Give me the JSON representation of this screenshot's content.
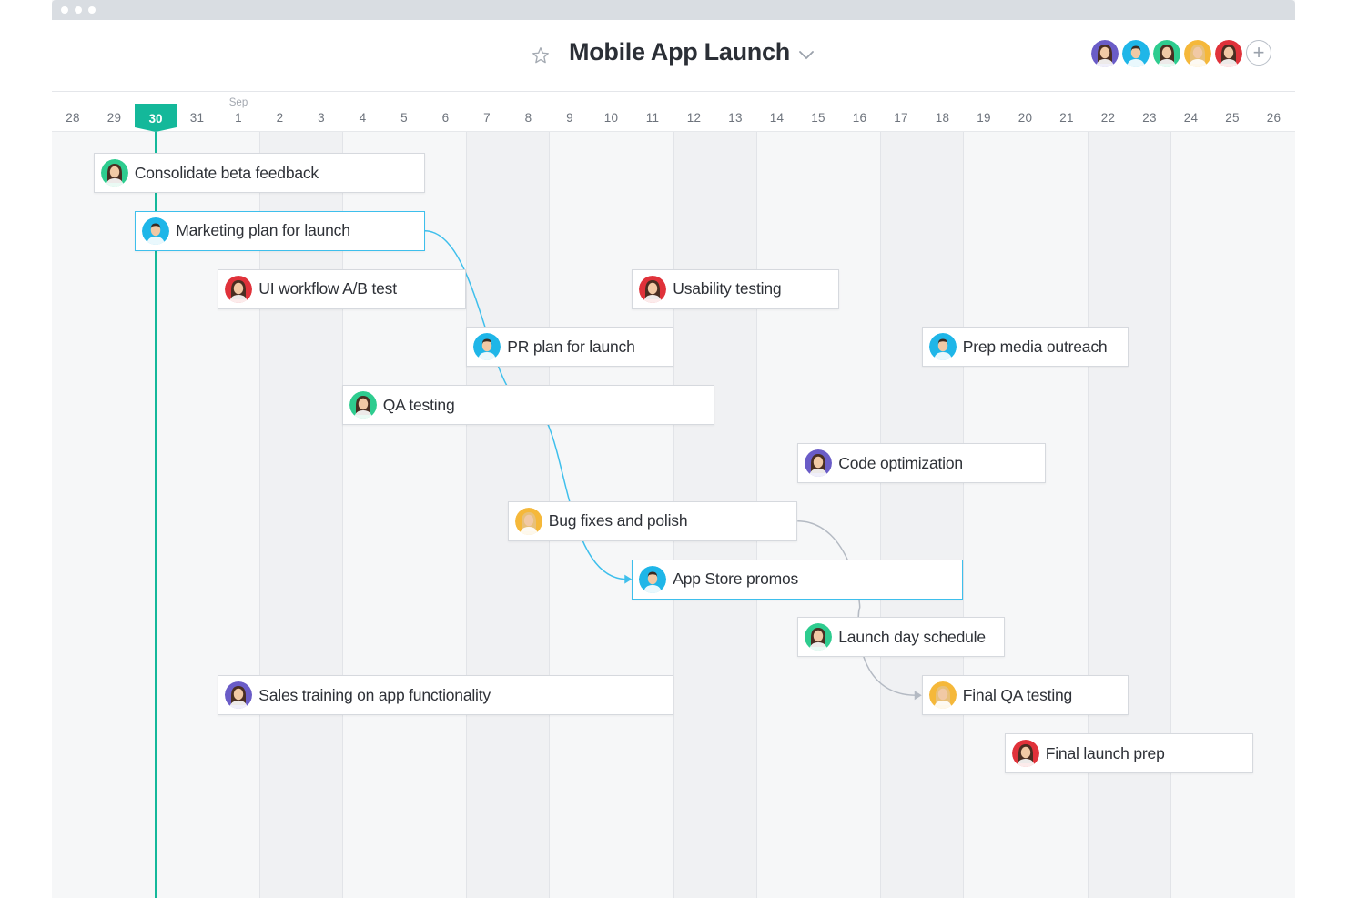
{
  "project": {
    "title": "Mobile App Launch"
  },
  "timeline": {
    "days": [
      {
        "label": "28"
      },
      {
        "label": "29"
      },
      {
        "label": "30",
        "today": true
      },
      {
        "label": "31"
      },
      {
        "label": "1",
        "month": "Sep"
      },
      {
        "label": "2"
      },
      {
        "label": "3"
      },
      {
        "label": "4"
      },
      {
        "label": "5"
      },
      {
        "label": "6"
      },
      {
        "label": "7"
      },
      {
        "label": "8"
      },
      {
        "label": "9"
      },
      {
        "label": "10"
      },
      {
        "label": "11"
      },
      {
        "label": "12"
      },
      {
        "label": "13"
      },
      {
        "label": "14"
      },
      {
        "label": "15"
      },
      {
        "label": "16"
      },
      {
        "label": "17"
      },
      {
        "label": "18"
      },
      {
        "label": "19"
      },
      {
        "label": "20"
      },
      {
        "label": "21"
      },
      {
        "label": "22"
      },
      {
        "label": "23"
      },
      {
        "label": "24"
      },
      {
        "label": "25"
      },
      {
        "label": "26"
      }
    ]
  },
  "tasks": [
    {
      "label": "Consolidate beta feedback",
      "start": "29",
      "end": "5",
      "row": 0,
      "avatar": "green"
    },
    {
      "label": "Marketing plan for launch",
      "start": "30",
      "end": "5",
      "row": 1,
      "avatar": "blue-man",
      "selected": true
    },
    {
      "label": "UI workflow A/B test",
      "start": "1",
      "end": "6",
      "row": 2,
      "avatar": "red"
    },
    {
      "label": "Usability testing",
      "start": "11",
      "end": "15",
      "row": 2,
      "avatar": "red"
    },
    {
      "label": "PR plan for launch",
      "start": "7",
      "end": "11",
      "row": 3,
      "avatar": "blue-man"
    },
    {
      "label": "Prep media outreach",
      "start": "18",
      "end": "22",
      "row": 3,
      "avatar": "blue-man"
    },
    {
      "label": "QA testing",
      "start": "4",
      "end": "12",
      "row": 4,
      "avatar": "green"
    },
    {
      "label": "Code optimization",
      "start": "15",
      "end": "20",
      "row": 5,
      "avatar": "purple"
    },
    {
      "label": "Bug fixes and polish",
      "start": "8",
      "end": "14",
      "row": 6,
      "avatar": "orange"
    },
    {
      "label": "App Store promos",
      "start": "11",
      "end": "18",
      "row": 7,
      "avatar": "blue-man",
      "selected": true
    },
    {
      "label": "Launch day schedule",
      "start": "15",
      "end": "19",
      "row": 8,
      "avatar": "green"
    },
    {
      "label": "Sales training on app functionality",
      "start": "1",
      "end": "11",
      "row": 9,
      "avatar": "purple"
    },
    {
      "label": "Final QA testing",
      "start": "18",
      "end": "22",
      "row": 9,
      "avatar": "orange"
    },
    {
      "label": "Final launch prep",
      "start": "20",
      "end": "25",
      "row": 10,
      "avatar": "red"
    }
  ],
  "dependencies": [
    {
      "from": "Marketing plan for launch",
      "to": "App Store promos",
      "color": "#3ebfec"
    },
    {
      "from": "Bug fixes and polish",
      "to": "Final QA testing",
      "color": "#b4bac3"
    }
  ],
  "members": [
    {
      "avatar": "purple"
    },
    {
      "avatar": "blue-man"
    },
    {
      "avatar": "green"
    },
    {
      "avatar": "orange"
    },
    {
      "avatar": "red"
    }
  ],
  "colors": {
    "accent_today": "#14b89a",
    "selected_border": "#3ebfec",
    "avatars": {
      "green": "#2ecc8f",
      "blue-man": "#1fb6e8",
      "red": "#e0323a",
      "purple": "#6a5cc7",
      "orange": "#f5b83a"
    }
  }
}
